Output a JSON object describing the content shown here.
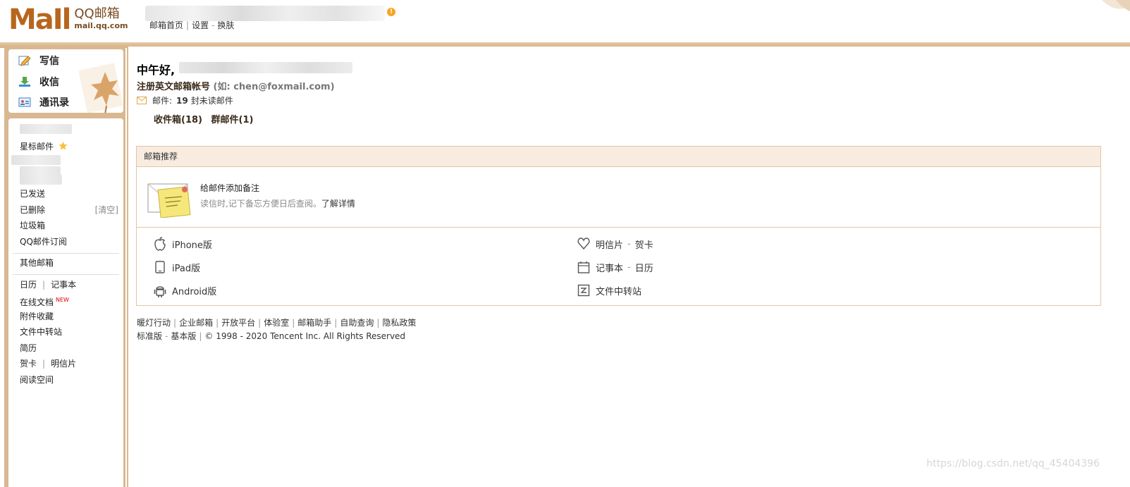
{
  "header": {
    "logo_text": "MaIl",
    "brand": "QQ邮箱",
    "domain": "mail.qq.com",
    "warning_glyph": "!",
    "links": [
      "邮箱首页",
      "设置",
      "换肤"
    ],
    "sep_pipe": "|",
    "sep_dash": "-"
  },
  "sidebar": {
    "write": "写信",
    "receive": "收信",
    "contacts": "通讯录",
    "starred": "星标邮件",
    "sent": "已发送",
    "deleted": "已删除",
    "clear": "[清空]",
    "spam": "垃圾箱",
    "subscribe": "QQ邮件订阅",
    "other": "其他邮箱",
    "calendar": "日历",
    "notepad": "记事本",
    "online_docs": "在线文档",
    "new_badge": "NEW",
    "attachments": "附件收藏",
    "file_transfer": "文件中转站",
    "resume": "简历",
    "greeting_card": "贺卡",
    "postcard": "明信片",
    "reading": "阅读空间"
  },
  "main": {
    "greeting": "中午好,",
    "register": "注册英文邮箱帐号",
    "register_hint": "(如: chen@foxmail.com)",
    "mail_label": "邮件:",
    "unread_count": "19",
    "unread_suffix": "封未读邮件",
    "inbox": "收件箱(18)",
    "group_mail": "群邮件(1)"
  },
  "recommend": {
    "title": "邮箱推荐",
    "note_title": "给邮件添加备注",
    "note_desc": "读信时,记下备忘方便日后查阅。",
    "note_link": "了解详情",
    "apps_left": [
      "iPhone版",
      "iPad版",
      "Android版"
    ],
    "postcard": "明信片",
    "card": "贺卡",
    "notepad": "记事本",
    "calendar": "日历",
    "file_transfer": "文件中转站"
  },
  "footer": {
    "links": [
      "暖灯行动",
      "企业邮箱",
      "开放平台",
      "体验室",
      "邮箱助手",
      "自助查询",
      "隐私政策"
    ],
    "standard": "标准版",
    "basic": "基本版",
    "copyright": "© 1998 - 2020 Tencent Inc. All Rights Reserved"
  },
  "watermark": "https://blog.csdn.net/qq_45404396",
  "colors": {
    "accent": "#b8661d",
    "frame": "#d9b891",
    "panel_header": "#f8ece0",
    "border": "#e3c4a6"
  }
}
